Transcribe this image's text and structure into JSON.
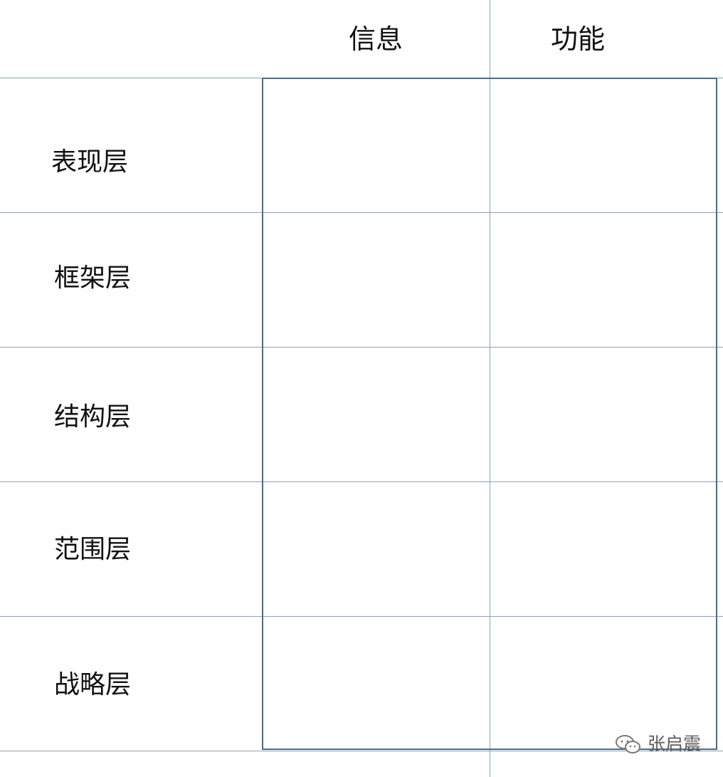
{
  "header": {
    "columns": [
      "信息",
      "功能"
    ]
  },
  "rows": [
    {
      "label": "表现层"
    },
    {
      "label": "框架层"
    },
    {
      "label": "结构层"
    },
    {
      "label": "范围层"
    },
    {
      "label": "战略层"
    }
  ],
  "watermark": {
    "text": "张启震",
    "icon": "wechat-icon"
  },
  "colors": {
    "grid_line": "#8aa1b6",
    "grid_box_border": "#4f6b86",
    "text": "#111111",
    "watermark_text": "#5b5b5b"
  }
}
